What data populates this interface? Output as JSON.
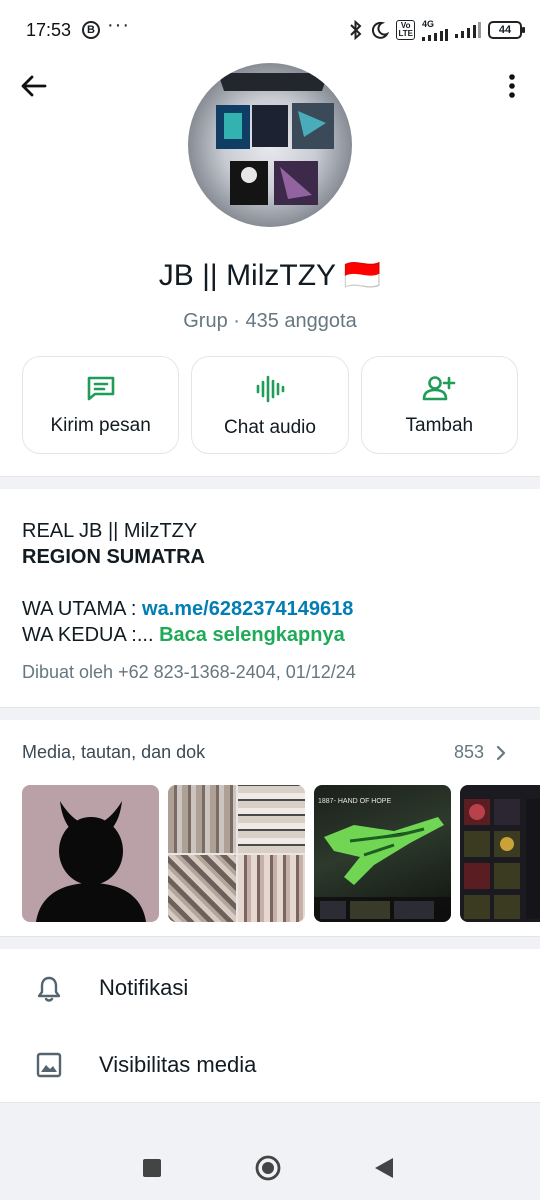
{
  "status_bar": {
    "time": "17:53",
    "notif_letter": "B",
    "dots": "···",
    "network": "4G",
    "volte_top": "Vo",
    "volte_bottom": "LTE",
    "battery": "44"
  },
  "header": {
    "back_icon": "arrow-left-icon",
    "more_icon": "more-vertical-icon"
  },
  "group": {
    "name": "JB || MilzTZY 🇮🇩",
    "type": "Grup",
    "separator": " · ",
    "members": "435 anggota"
  },
  "actions": [
    {
      "label": "Kirim pesan",
      "icon": "message-icon"
    },
    {
      "label": "Chat audio",
      "icon": "audio-wave-icon"
    },
    {
      "label": "Tambah",
      "icon": "add-person-icon"
    }
  ],
  "description": {
    "line1": "REAL JB || MilzTZY",
    "line2": "REGION SUMATRA",
    "line3_prefix": "WA UTAMA : ",
    "line3_link": "wa.me/6282374149618",
    "line4_prefix": "WA KEDUA :... ",
    "line4_more": "Baca selengkapnya"
  },
  "created_by": "Dibuat oleh +62 823-1368-2404, 01/12/24",
  "media": {
    "title": "Media, tautan, dan dok",
    "count": "853",
    "thumb3_caption": "1887- HAND OF HOPE"
  },
  "settings": [
    {
      "label": "Notifikasi",
      "icon": "bell-icon"
    },
    {
      "label": "Visibilitas media",
      "icon": "image-icon"
    }
  ],
  "colors": {
    "accent_green": "#1faa59",
    "link_blue": "#027eb5",
    "icon_green": "#1f9c58"
  }
}
